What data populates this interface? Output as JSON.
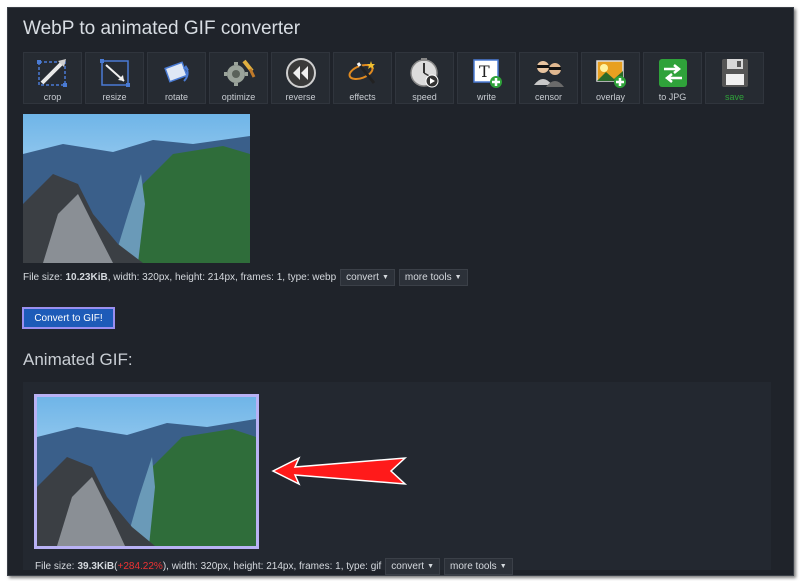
{
  "page": {
    "title": "WebP to animated GIF converter"
  },
  "toolbar": [
    {
      "label": "crop",
      "icon": "crop-icon"
    },
    {
      "label": "resize",
      "icon": "resize-icon"
    },
    {
      "label": "rotate",
      "icon": "rotate-icon"
    },
    {
      "label": "optimize",
      "icon": "optimize-icon"
    },
    {
      "label": "reverse",
      "icon": "reverse-icon"
    },
    {
      "label": "effects",
      "icon": "effects-icon"
    },
    {
      "label": "speed",
      "icon": "speed-icon"
    },
    {
      "label": "write",
      "icon": "write-icon"
    },
    {
      "label": "censor",
      "icon": "censor-icon"
    },
    {
      "label": "overlay",
      "icon": "overlay-icon"
    },
    {
      "label": "to JPG",
      "icon": "to-jpg-icon"
    },
    {
      "label": "save",
      "icon": "save-icon",
      "color": "#2fa23a"
    }
  ],
  "source": {
    "info_prefix": "File size:",
    "size": "10.23KiB",
    "info_rest": ", width: 320px, height: 214px, frames: 1, type: webp",
    "convert_label": "convert",
    "more_tools_label": "more tools"
  },
  "convert_button": {
    "label": "Convert to GIF!"
  },
  "output": {
    "section_title": "Animated GIF:",
    "info_prefix": "File size:",
    "size": "39.3KiB",
    "paren_open": " (",
    "change": "+284.22%",
    "info_rest": "), width: 320px, height: 214px, frames: 1, type: gif",
    "convert_label": "convert",
    "more_tools_label": "more tools"
  },
  "colors": {
    "accent": "#1d5bb8",
    "highlight_border": "#9a8ff0",
    "arrow": "#ff1a1a",
    "change": "#e33"
  }
}
